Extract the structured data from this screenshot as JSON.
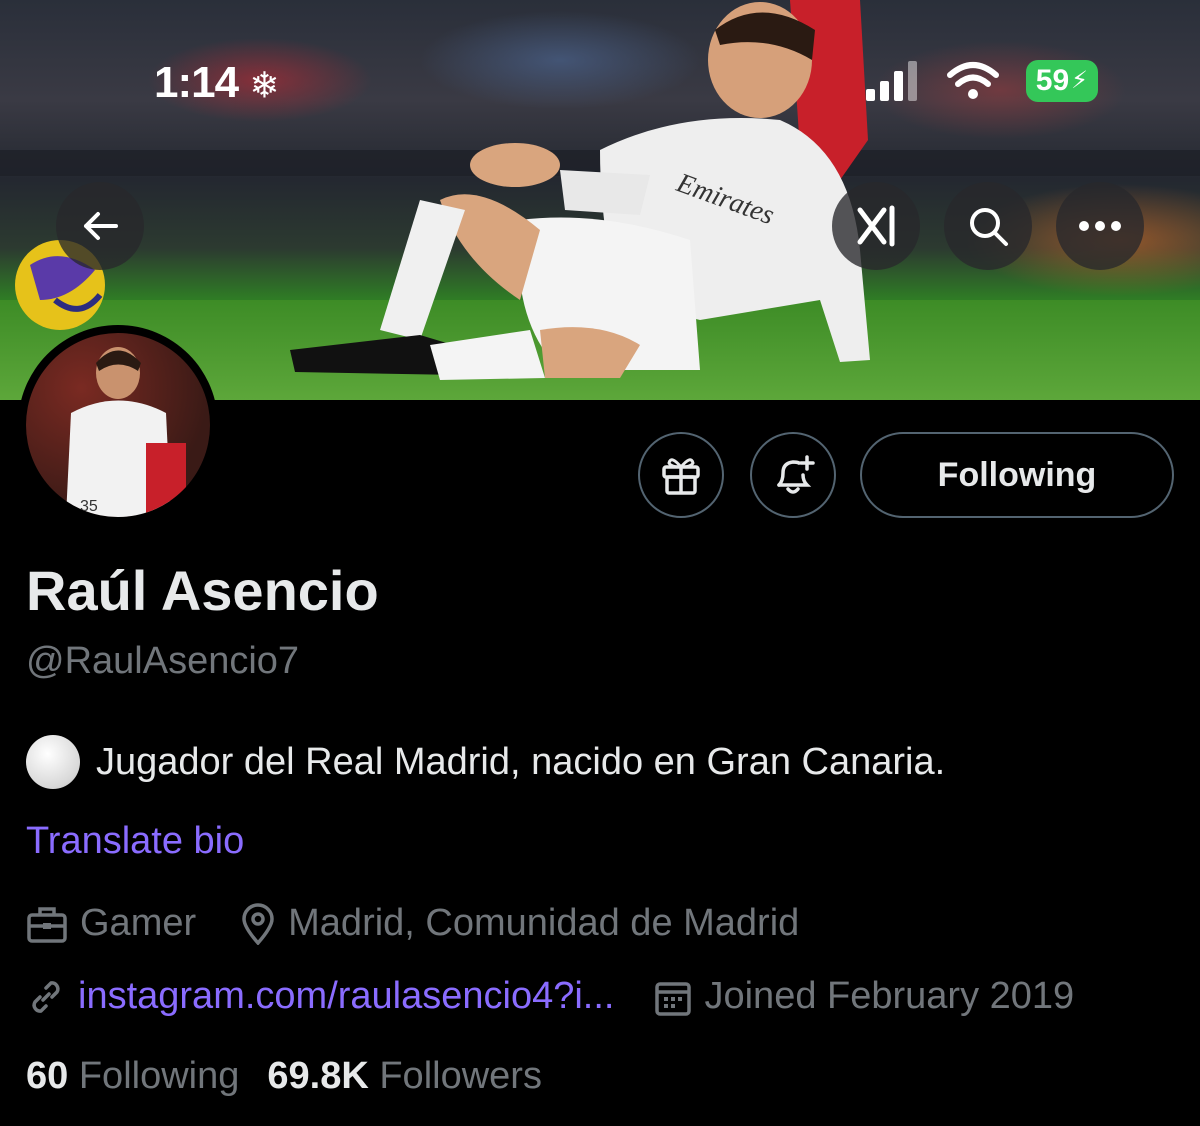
{
  "status_bar": {
    "time": "1:14",
    "battery": "59"
  },
  "header": {
    "back_icon": "arrow-left-icon",
    "grok_icon": "grok-icon",
    "search_icon": "search-icon",
    "more_icon": "more-horizontal-icon"
  },
  "actions": {
    "gift_icon": "gift-icon",
    "notify_icon": "bell-plus-icon",
    "following_label": "Following"
  },
  "profile": {
    "name": "Raúl Asencio",
    "handle": "@RaulAsencio7",
    "bio": "Jugador del Real Madrid, nacido en Gran Canaria.",
    "translate_label": "Translate bio",
    "category": "Gamer",
    "location": "Madrid, Comunidad de Madrid",
    "website": "instagram.com/raulasencio4?i...",
    "joined": "Joined February 2019",
    "following_count": "60",
    "following_label": "Following",
    "followers_count": "69.8K",
    "followers_label": "Followers"
  },
  "colors": {
    "link": "#8a6cff",
    "muted": "#71767b",
    "text": "#e7e9ea",
    "battery": "#34c759"
  }
}
